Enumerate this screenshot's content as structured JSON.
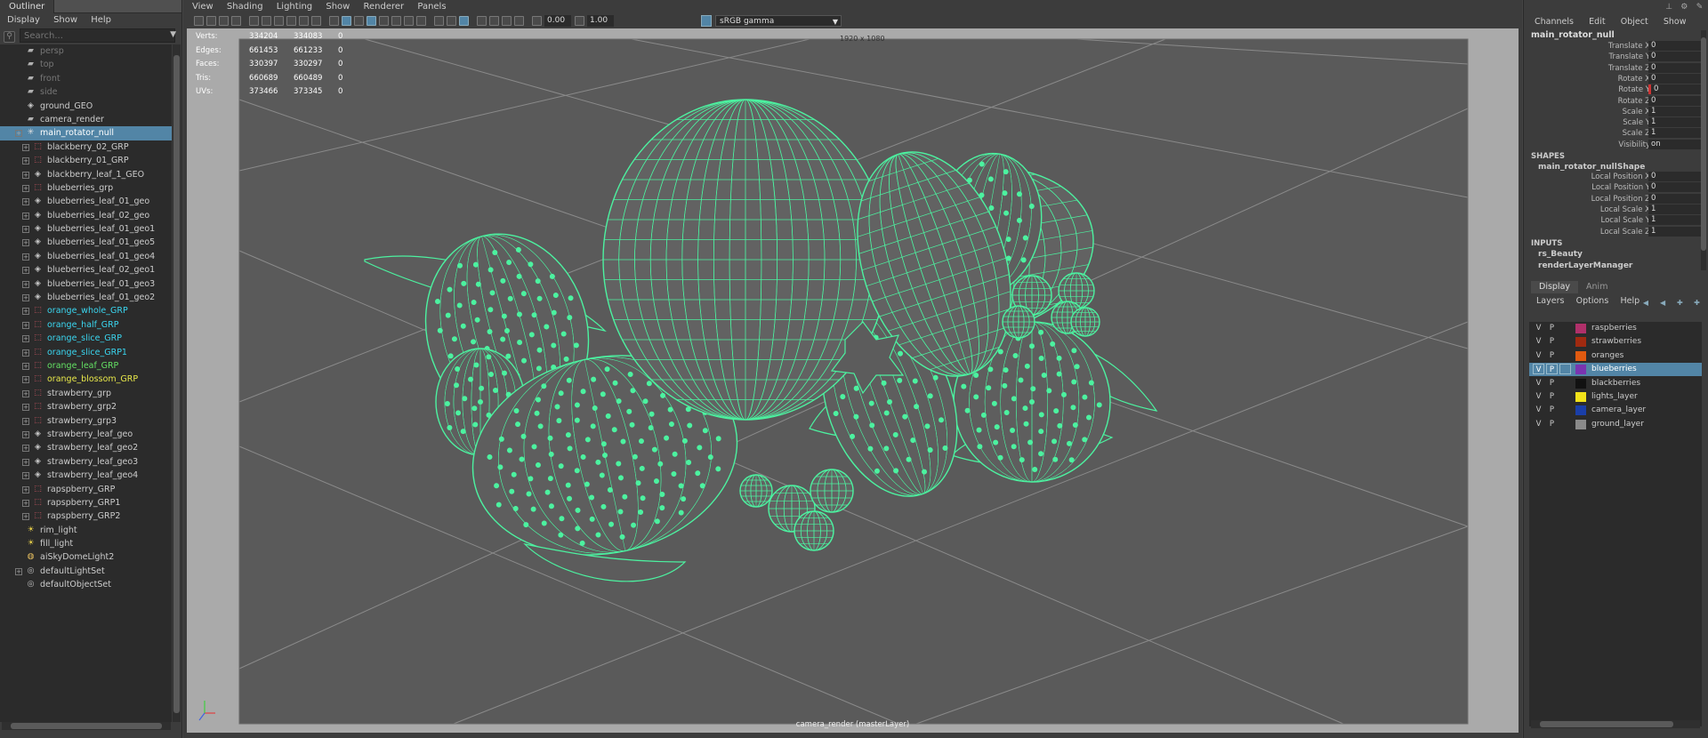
{
  "outliner": {
    "tab": "Outliner",
    "menu": [
      "Display",
      "Show",
      "Help"
    ],
    "search_placeholder": "Search...",
    "items": [
      {
        "label": "persp",
        "indent": 0,
        "icon": "camera-icon",
        "expand": false,
        "color": "#777777"
      },
      {
        "label": "top",
        "indent": 0,
        "icon": "camera-icon",
        "expand": false,
        "color": "#777777"
      },
      {
        "label": "front",
        "indent": 0,
        "icon": "camera-icon",
        "expand": false,
        "color": "#777777"
      },
      {
        "label": "side",
        "indent": 0,
        "icon": "camera-icon",
        "expand": false,
        "color": "#777777"
      },
      {
        "label": "ground_GEO",
        "indent": 0,
        "icon": "mesh-icon",
        "expand": false,
        "color": "#cccccc"
      },
      {
        "label": "camera_render",
        "indent": 0,
        "icon": "camera-icon",
        "expand": false,
        "color": "#cccccc"
      },
      {
        "label": "main_rotator_null",
        "indent": 0,
        "icon": "locator-icon",
        "expand": true,
        "color": "#ffffff",
        "selected": true
      },
      {
        "label": "blackberry_02_GRP",
        "indent": 1,
        "icon": "group-icon",
        "expand": true,
        "color": "#cccccc"
      },
      {
        "label": "blackberry_01_GRP",
        "indent": 1,
        "icon": "group-icon",
        "expand": true,
        "color": "#cccccc"
      },
      {
        "label": "blackberry_leaf_1_GEO",
        "indent": 1,
        "icon": "mesh-icon",
        "expand": true,
        "color": "#cccccc"
      },
      {
        "label": "blueberries_grp",
        "indent": 1,
        "icon": "group-icon",
        "expand": true,
        "color": "#cccccc"
      },
      {
        "label": "blueberries_leaf_01_geo",
        "indent": 1,
        "icon": "mesh-icon",
        "expand": true,
        "color": "#cccccc"
      },
      {
        "label": "blueberries_leaf_02_geo",
        "indent": 1,
        "icon": "mesh-icon",
        "expand": true,
        "color": "#cccccc"
      },
      {
        "label": "blueberries_leaf_01_geo1",
        "indent": 1,
        "icon": "mesh-icon",
        "expand": true,
        "color": "#cccccc"
      },
      {
        "label": "blueberries_leaf_01_geo5",
        "indent": 1,
        "icon": "mesh-icon",
        "expand": true,
        "color": "#cccccc"
      },
      {
        "label": "blueberries_leaf_01_geo4",
        "indent": 1,
        "icon": "mesh-icon",
        "expand": true,
        "color": "#cccccc"
      },
      {
        "label": "blueberries_leaf_02_geo1",
        "indent": 1,
        "icon": "mesh-icon",
        "expand": true,
        "color": "#cccccc"
      },
      {
        "label": "blueberries_leaf_01_geo3",
        "indent": 1,
        "icon": "mesh-icon",
        "expand": true,
        "color": "#cccccc"
      },
      {
        "label": "blueberries_leaf_01_geo2",
        "indent": 1,
        "icon": "mesh-icon",
        "expand": true,
        "color": "#cccccc"
      },
      {
        "label": "orange_whole_GRP",
        "indent": 1,
        "icon": "group-icon",
        "expand": true,
        "color": "#3ad6f0"
      },
      {
        "label": "orange_half_GRP",
        "indent": 1,
        "icon": "group-icon",
        "expand": true,
        "color": "#3ad6f0"
      },
      {
        "label": "orange_slice_GRP",
        "indent": 1,
        "icon": "group-icon",
        "expand": true,
        "color": "#3ad6f0"
      },
      {
        "label": "orange_slice_GRP1",
        "indent": 1,
        "icon": "group-icon",
        "expand": true,
        "color": "#3ad6f0"
      },
      {
        "label": "orange_leaf_GRP",
        "indent": 1,
        "icon": "group-icon",
        "expand": true,
        "color": "#63e063"
      },
      {
        "label": "orange_blossom_GRP",
        "indent": 1,
        "icon": "group-icon",
        "expand": true,
        "color": "#e8e84a"
      },
      {
        "label": "strawberry_grp",
        "indent": 1,
        "icon": "group-icon",
        "expand": true,
        "color": "#cccccc"
      },
      {
        "label": "strawberry_grp2",
        "indent": 1,
        "icon": "group-icon",
        "expand": true,
        "color": "#cccccc"
      },
      {
        "label": "strawberry_grp3",
        "indent": 1,
        "icon": "group-icon",
        "expand": true,
        "color": "#cccccc"
      },
      {
        "label": "strawberry_leaf_geo",
        "indent": 1,
        "icon": "mesh-icon",
        "expand": true,
        "color": "#cccccc"
      },
      {
        "label": "strawberry_leaf_geo2",
        "indent": 1,
        "icon": "mesh-icon",
        "expand": true,
        "color": "#cccccc"
      },
      {
        "label": "strawberry_leaf_geo3",
        "indent": 1,
        "icon": "mesh-icon",
        "expand": true,
        "color": "#cccccc"
      },
      {
        "label": "strawberry_leaf_geo4",
        "indent": 1,
        "icon": "mesh-icon",
        "expand": true,
        "color": "#cccccc"
      },
      {
        "label": "rapspberry_GRP",
        "indent": 1,
        "icon": "group-icon",
        "expand": true,
        "color": "#cccccc"
      },
      {
        "label": "rapspberry_GRP1",
        "indent": 1,
        "icon": "group-icon",
        "expand": true,
        "color": "#cccccc"
      },
      {
        "label": "rapspberry_GRP2",
        "indent": 1,
        "icon": "group-icon",
        "expand": true,
        "color": "#cccccc"
      },
      {
        "label": "rim_light",
        "indent": 0,
        "icon": "light-icon",
        "expand": false,
        "color": "#cccccc"
      },
      {
        "label": "fill_light",
        "indent": 0,
        "icon": "light-icon",
        "expand": false,
        "color": "#cccccc"
      },
      {
        "label": "aiSkyDomeLight2",
        "indent": 0,
        "icon": "dome-light-icon",
        "expand": false,
        "color": "#cccccc"
      },
      {
        "label": "defaultLightSet",
        "indent": 0,
        "icon": "set-icon",
        "expand": true,
        "color": "#cccccc"
      },
      {
        "label": "defaultObjectSet",
        "indent": 0,
        "icon": "set-icon",
        "expand": false,
        "color": "#cccccc"
      }
    ]
  },
  "viewport_panel": {
    "menu": [
      "View",
      "Shading",
      "Lighting",
      "Show",
      "Renderer",
      "Panels"
    ],
    "exposure": "0.00",
    "gamma": "1.00",
    "color_space": "sRGB gamma"
  },
  "viewport": {
    "hud": [
      {
        "label": "Verts:",
        "a": "334204",
        "b": "334083",
        "c": "0"
      },
      {
        "label": "Edges:",
        "a": "661453",
        "b": "661233",
        "c": "0"
      },
      {
        "label": "Faces:",
        "a": "330397",
        "b": "330297",
        "c": "0"
      },
      {
        "label": "Tris:",
        "a": "660689",
        "b": "660489",
        "c": "0"
      },
      {
        "label": "UVs:",
        "a": "373466",
        "b": "373345",
        "c": "0"
      }
    ],
    "resolution": "1920 x 1080",
    "camera_label": "camera_render (masterLayer)",
    "wire_color": "#4cf2a0",
    "background_color": "#aaaaaa"
  },
  "channel_box": {
    "menu": [
      "Channels",
      "Edit",
      "Object",
      "Show"
    ],
    "object_name": "main_rotator_null",
    "attributes": [
      {
        "name": "Translate X",
        "value": "0"
      },
      {
        "name": "Translate Y",
        "value": "0"
      },
      {
        "name": "Translate Z",
        "value": "0"
      },
      {
        "name": "Rotate X",
        "value": "0"
      },
      {
        "name": "Rotate Y",
        "value": "0",
        "keyed": true
      },
      {
        "name": "Rotate Z",
        "value": "0"
      },
      {
        "name": "Scale X",
        "value": "1"
      },
      {
        "name": "Scale Y",
        "value": "1"
      },
      {
        "name": "Scale Z",
        "value": "1"
      },
      {
        "name": "Visibility",
        "value": "on"
      }
    ],
    "shapes_header": "SHAPES",
    "shape_name": "main_rotator_nullShape",
    "shape_attributes": [
      {
        "name": "Local Position X",
        "value": "0"
      },
      {
        "name": "Local Position Y",
        "value": "0"
      },
      {
        "name": "Local Position Z",
        "value": "0"
      },
      {
        "name": "Local Scale X",
        "value": "1"
      },
      {
        "name": "Local Scale Y",
        "value": "1"
      },
      {
        "name": "Local Scale Z",
        "value": "1"
      }
    ],
    "inputs_header": "INPUTS",
    "inputs": [
      "rs_Beauty",
      "renderLayerManager"
    ]
  },
  "layer_editor": {
    "tabs": [
      "Display",
      "Anim"
    ],
    "menu": [
      "Layers",
      "Options",
      "Help"
    ],
    "layers": [
      {
        "v": "V",
        "p": "P",
        "name": "raspberries",
        "color": "#b0306a"
      },
      {
        "v": "V",
        "p": "P",
        "name": "strawberries",
        "color": "#a02a10"
      },
      {
        "v": "V",
        "p": "P",
        "name": "oranges",
        "color": "#e05a10"
      },
      {
        "v": "V",
        "p": "P",
        "name": "blueberries",
        "color": "#7a34b0",
        "selected": true
      },
      {
        "v": "V",
        "p": "P",
        "name": "blackberries",
        "color": "#111111"
      },
      {
        "v": "V",
        "p": "P",
        "name": "lights_layer",
        "color": "#f2e21a"
      },
      {
        "v": "V",
        "p": "P",
        "name": "camera_layer",
        "color": "#1a3ea8"
      },
      {
        "v": "V",
        "p": "P",
        "name": "ground_layer",
        "color": "#8a8a8a"
      }
    ]
  }
}
